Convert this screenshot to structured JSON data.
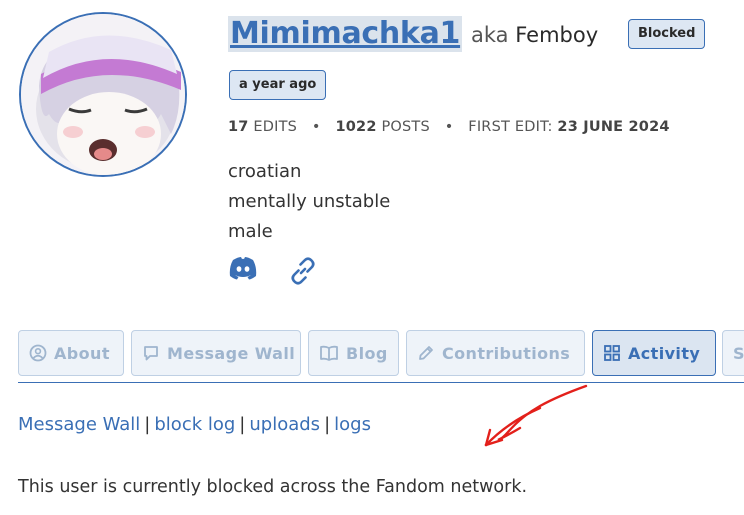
{
  "profile": {
    "username": "Mimimachka1",
    "aka_prefix": "aka",
    "nickname": "Femboy",
    "blocked_badge": "Blocked",
    "age_badge": "a year ago",
    "stats": {
      "edits_count": "17",
      "edits_label": "EDITS",
      "posts_count": "1022",
      "posts_label": "POSTS",
      "first_edit_label": "FIRST EDIT:",
      "first_edit_date": "23 JUNE 2024",
      "separator": "•"
    },
    "bio": [
      "croatian",
      "mentally unstable",
      "male"
    ],
    "icons": [
      "discord-icon",
      "link-icon"
    ]
  },
  "tabs": [
    {
      "label": "About",
      "icon": "user-circle-icon",
      "active": false
    },
    {
      "label": "Message Wall",
      "icon": "speech-bubble-icon",
      "active": false
    },
    {
      "label": "Blog",
      "icon": "book-icon",
      "active": false
    },
    {
      "label": "Contributions",
      "icon": "pencil-icon",
      "active": false
    },
    {
      "label": "Activity",
      "icon": "grid-icon",
      "active": true
    },
    {
      "label": "S",
      "icon": "",
      "active": false
    }
  ],
  "links": [
    "Message Wall",
    "block log",
    "uploads",
    "logs"
  ],
  "link_separator": "|",
  "notice": "This user is currently blocked across the Fandom network.",
  "colors": {
    "accent": "#3a6fb5",
    "tab_inactive_text": "#9fb5ce",
    "annotation_arrow": "#e3201b"
  }
}
